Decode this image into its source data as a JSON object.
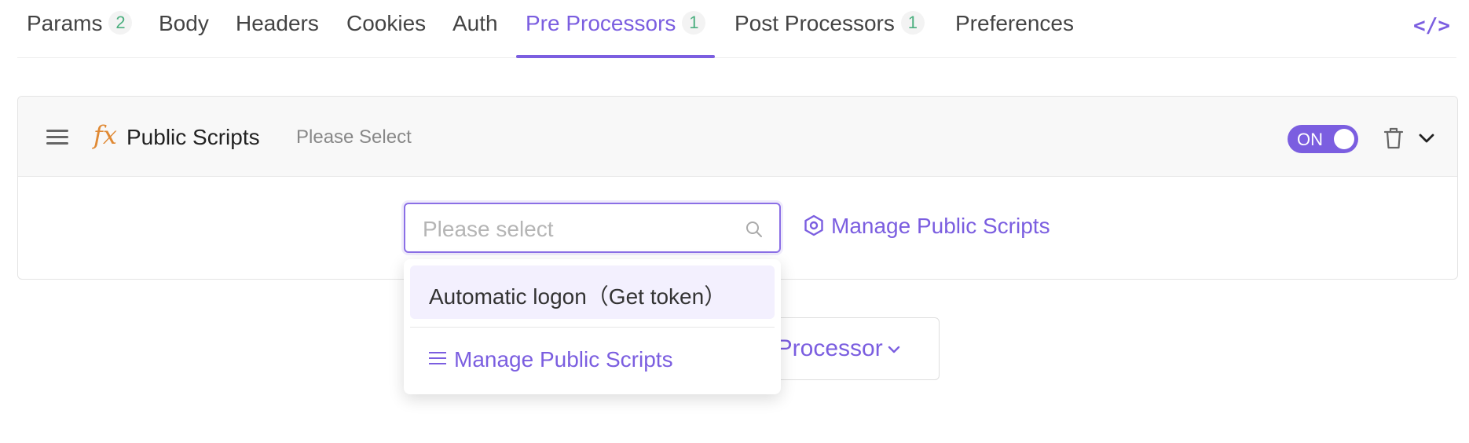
{
  "tabs": [
    {
      "label": "Params",
      "count": "2"
    },
    {
      "label": "Body"
    },
    {
      "label": "Headers"
    },
    {
      "label": "Cookies"
    },
    {
      "label": "Auth"
    },
    {
      "label": "Pre Processors",
      "count": "1",
      "active": true
    },
    {
      "label": "Post Processors",
      "count": "1"
    },
    {
      "label": "Preferences"
    }
  ],
  "toolbar": {
    "code_icon": "</>"
  },
  "processor": {
    "fx_label": "fx",
    "title": "Public Scripts",
    "subtitle": "Please Select",
    "toggle_label": "ON",
    "enabled": true
  },
  "select": {
    "placeholder": "Please select",
    "manage_link": "Manage Public Scripts"
  },
  "dropdown": {
    "options": [
      "Automatic logon（Get token）"
    ],
    "manage_label": "Manage Public Scripts"
  },
  "add_button": {
    "label": "Add PreProcessor"
  },
  "colors": {
    "accent": "#7b5ee0",
    "fx": "#e08a35",
    "count": "#4caf7f"
  }
}
